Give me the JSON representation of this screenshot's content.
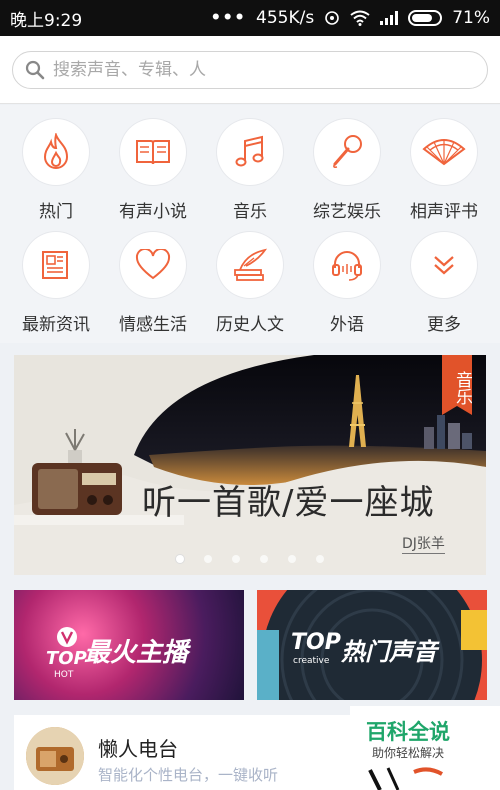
{
  "status_bar": {
    "time": "晚上9:29",
    "dots": "•••",
    "speed": "455K/s",
    "battery": "71%"
  },
  "search": {
    "placeholder": "搜索声音、专辑、人"
  },
  "categories": [
    {
      "label": "热门",
      "icon": "flame-icon"
    },
    {
      "label": "有声小说",
      "icon": "book-icon"
    },
    {
      "label": "音乐",
      "icon": "music-note-icon"
    },
    {
      "label": "综艺娱乐",
      "icon": "microphone-icon"
    },
    {
      "label": "相声评书",
      "icon": "fan-icon"
    },
    {
      "label": "最新资讯",
      "icon": "newspaper-icon"
    },
    {
      "label": "情感生活",
      "icon": "heart-icon"
    },
    {
      "label": "历史人文",
      "icon": "quill-books-icon"
    },
    {
      "label": "外语",
      "icon": "headset-icon"
    },
    {
      "label": "更多",
      "icon": "double-chevron-down-icon"
    }
  ],
  "banner": {
    "tag": "音乐",
    "slogan": "听一首歌/爱一座城",
    "author": "DJ张羊",
    "slide_count": 6,
    "active_slide": 1
  },
  "cards": [
    {
      "top": "TOP",
      "sub": "HOT",
      "title": "最火主播"
    },
    {
      "top": "TOP",
      "sub": "creative",
      "title": "热门声音"
    }
  ],
  "radio": {
    "title": "懒人电台",
    "subtitle": "智能化个性电台，一键收听"
  },
  "watermark": {
    "title": "百科全说",
    "subtitle": "助你轻松解决"
  },
  "colors": {
    "accent": "#f0643c",
    "tag": "#e1532a"
  }
}
